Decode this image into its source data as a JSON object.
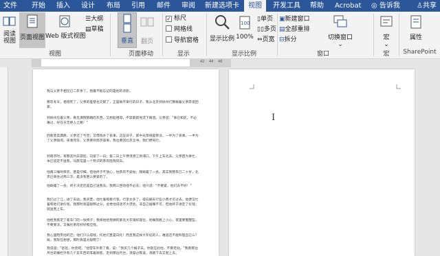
{
  "tabs": [
    "文件",
    "开始",
    "插入",
    "设计",
    "布局",
    "引用",
    "邮件",
    "审阅",
    "新建选项卡",
    "视图",
    "开发工具",
    "帮助",
    "Acrobat"
  ],
  "active_tab": "视图",
  "tell_me": "告诉我",
  "share": "共享",
  "ribbon": {
    "views": {
      "read_mode": "阅读视图",
      "print_layout": "页面视图",
      "web_layout": "Web 版式视图",
      "outline": "大纲",
      "draft": "草稿",
      "label": "视图"
    },
    "page_movement": {
      "vertical": "垂直",
      "side_to_side": "翻页",
      "label": "页面移动"
    },
    "show": {
      "ruler": "标尺",
      "gridlines": "网格线",
      "nav_pane": "导航窗格",
      "label": "显示",
      "ruler_checked": true,
      "gridlines_checked": false,
      "nav_checked": false
    },
    "zoom": {
      "zoom": "显示比例",
      "hundred": "100%",
      "one_page": "单页",
      "multiple_pages": "多页",
      "page_width": "页宽",
      "label": "显示比例"
    },
    "window": {
      "new_window": "新建窗口",
      "arrange_all": "全部重排",
      "split": "拆分",
      "switch_windows": "切换窗口",
      "label": "窗口"
    },
    "macros": {
      "macros": "宏",
      "label": "宏"
    },
    "sharepoint": {
      "properties": "属性",
      "label": "SharePoint"
    }
  },
  "ruler_numbers": [
    "42",
    "44",
    "46"
  ],
  "document_paragraphs": [
    "我与父亲不相见已二年余了，我最不能忘记的是他的背影。",
    "那年冬天，祖母死了，父亲的差使也交卸了，正是祸不单行的日子。我从北京到徐州打算跟着父亲奔丧回家。",
    "到徐州见着父亲，看见满院狼藉的东西，又想起祖母，不禁簌簌地流下眼泪。父亲说：\"事已如此，不必难过，好在天无绝人之路！\"",
    "回家变卖典质，父亲还了亏空；又借钱办了丧事。这些日子，家中光景很是惨淡，一半为了丧事，一半为了父亲赋闲。丧事完毕，父亲要到南京谋事，我也要回北京念书，我们便同行。",
    "到南京时，有朋友约去游逛，勾留了一日；第二日上午便须渡江到浦口，下午上车北去。父亲因为事忙，本已说定不送我，叫旅馆里一个熟识的茶房陪我同去。",
    "他再三嘱咐茶房，甚是仔细。但他终于不放心，怕茶房不妥帖；颇踌躇了一会。其实我那年已二十岁，北京已来往过两三次，是没有甚么要紧的了。",
    "他踌躇了一会，终于决定还是自己送我去。我两三回劝他不必去；他只说：\"不要紧，他们去不好！\"",
    "我们过了江，进了车站。我买票，他忙着照看行李。行李太多了，得向脚夫行些小费才可过去。他便又忙着和他们讲价钱。我那时真是聪明过分，总觉他说话不大漂亮，非自己插嘴不可，但他终于讲定了价钱；就送我上车。",
    "他给我拣定了靠车门的一张椅子；我将他给我做的紫毛大衣铺好座位。他嘱我路上小心，夜里要警醒些，不要受凉。又嘱托茶房好好照应我。",
    "我心里暗笑他的迂；他们只认得钱，托他们直是白托！而且我这样大年纪的人，难道还不能料理自己么？唉，我现在想想，那时真是太聪明了！",
    "我说道：\"爸爸，你走吧。\"他望车外看了看，说：\"我买几个橘子去。你就在此地，不要走动。\"我看那边月台的栅栏外有几个卖东西的等着顾客。走到那边月台，须穿过铁道，须跳下去又爬上去。"
  ]
}
